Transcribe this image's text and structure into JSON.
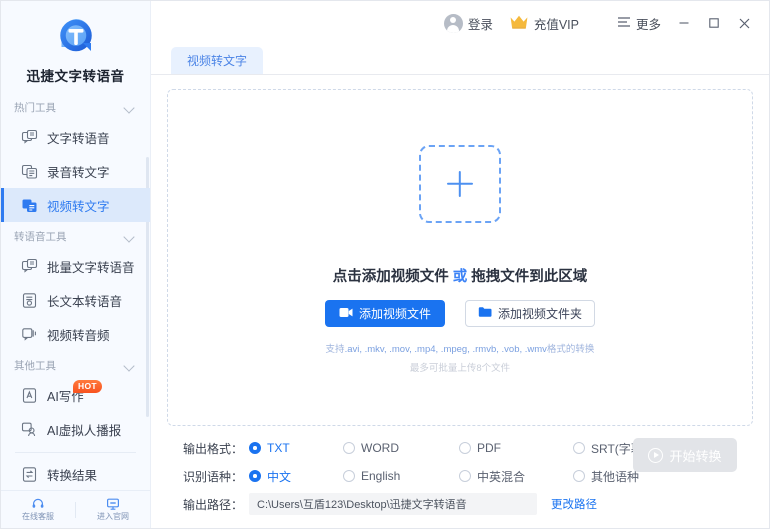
{
  "app": {
    "brand_name": "迅捷文字转语音",
    "logo_icon": "app-logo-icon"
  },
  "sidebar": {
    "groups": [
      {
        "title": "热门工具",
        "chevron_icon": "chevron-down-icon",
        "items": [
          {
            "label": "文字转语音",
            "icon": "text-to-speech-icon",
            "active": false
          },
          {
            "label": "录音转文字",
            "icon": "recording-to-text-icon",
            "active": false
          },
          {
            "label": "视频转文字",
            "icon": "video-to-text-icon",
            "active": true
          }
        ]
      },
      {
        "title": "转语音工具",
        "chevron_icon": "chevron-down-icon",
        "items": [
          {
            "label": "批量文字转语音",
            "icon": "batch-text-to-speech-icon",
            "active": false
          },
          {
            "label": "长文本转语音",
            "icon": "long-text-to-speech-icon",
            "active": false
          },
          {
            "label": "视频转音频",
            "icon": "video-to-audio-icon",
            "active": false
          }
        ]
      },
      {
        "title": "其他工具",
        "chevron_icon": "chevron-down-icon",
        "items": [
          {
            "label": "AI写作",
            "icon": "ai-writing-icon",
            "badge": "HOT",
            "active": false
          },
          {
            "label": "AI虚拟人播报",
            "icon": "ai-avatar-broadcast-icon",
            "active": false
          }
        ]
      }
    ],
    "results_item": {
      "label": "转换结果",
      "icon": "conversion-results-icon"
    },
    "footer": [
      {
        "label": "在线客服",
        "icon": "headset-icon"
      },
      {
        "label": "进入官网",
        "icon": "monitor-icon"
      }
    ]
  },
  "titlebar": {
    "login": {
      "label": "登录",
      "icon": "avatar-icon"
    },
    "vip": {
      "label": "充值VIP",
      "icon": "crown-icon"
    },
    "more": {
      "label": "更多",
      "icon": "hamburger-icon"
    },
    "minimize_icon": "minimize-icon",
    "maximize_icon": "maximize-icon",
    "close_icon": "close-icon"
  },
  "tabs": [
    {
      "label": "视频转文字",
      "active": true
    }
  ],
  "dropzone": {
    "plus_icon": "plus-icon",
    "title_main": "点击添加视频文件",
    "title_or": "或",
    "title_tail": "拖拽文件到此区域",
    "add_file_button": {
      "label": "添加视频文件",
      "icon": "video-file-icon"
    },
    "add_folder_button": {
      "label": "添加视频文件夹",
      "icon": "folder-icon"
    },
    "formats_prefix": "支持",
    "formats_list": ".avi, .mkv, .mov, .mp4, .mpeg, .rmvb, .vob, .wmv",
    "formats_suffix": "格式的转换",
    "limit_text": "最多可批量上传8个文件"
  },
  "options": {
    "output_format": {
      "label": "输出格式：",
      "choices": [
        "TXT",
        "WORD",
        "PDF",
        "SRT(字幕)"
      ],
      "selected": "TXT"
    },
    "language": {
      "label": "识别语种：",
      "choices": [
        "中文",
        "English",
        "中英混合",
        "其他语种"
      ],
      "selected": "中文"
    },
    "output_path": {
      "label": "输出路径：",
      "value": "C:\\Users\\互盾123\\Desktop\\迅捷文字转语音",
      "change_link": "更改路径"
    },
    "start_button": {
      "label": "开始转换",
      "icon": "play-icon",
      "disabled": true
    }
  },
  "colors": {
    "accent": "#1a73f0",
    "sidebar_active_bg": "#dce9fb",
    "hot_badge": "#f8521f",
    "vip_gold": "#f5b93c"
  }
}
